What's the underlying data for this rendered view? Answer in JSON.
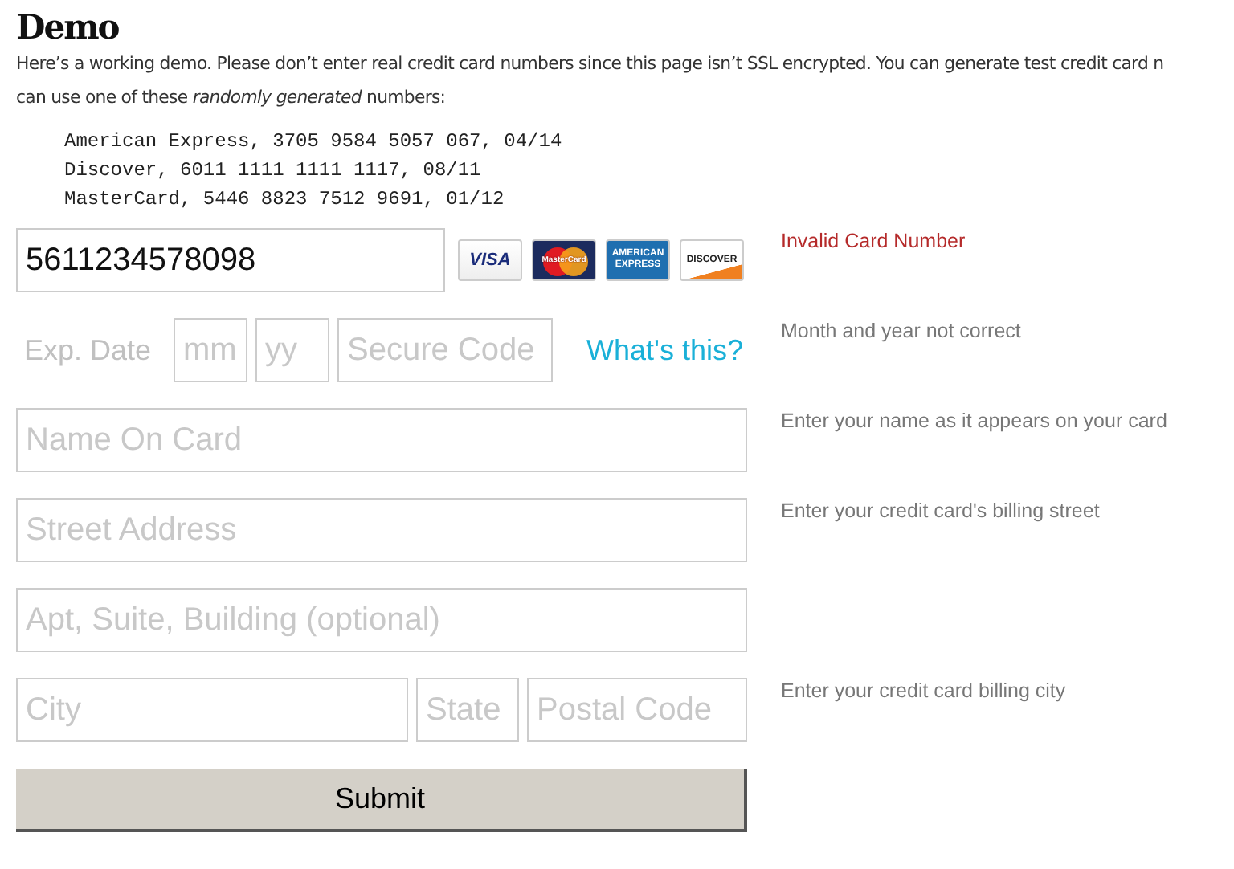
{
  "heading": "Demo",
  "intro_lines": [
    "Here’s a working demo.  Please don’t enter real credit card numbers since this page isn’t SSL encrypted.  You can generate test credit card n",
    "can use one of these *randomly generated* numbers:"
  ],
  "test_numbers": [
    "American Express, 3705 9584 5057 067, 04/14",
    "Discover, 6011 1111 1111 1117, 08/11",
    "MasterCard, 5446 8823 7512 9691, 01/12"
  ],
  "card_row": {
    "number": {
      "value": "5611234578098"
    },
    "cards": [
      {
        "kind": "visa",
        "label": "VISA"
      },
      {
        "kind": "mastercard",
        "label": "MasterCard"
      },
      {
        "kind": "amex",
        "label": "AMERICAN EXPRESS"
      },
      {
        "kind": "discover",
        "label": "DISCOVER"
      }
    ],
    "message": {
      "kind": "error",
      "text": "Invalid Card Number"
    }
  },
  "expiry_row": {
    "label": "Exp. Date",
    "month": {
      "placeholder": "mm"
    },
    "year": {
      "placeholder": "yy"
    },
    "code": {
      "placeholder": "Secure Code"
    },
    "help_link": "What's this?",
    "message": {
      "kind": "hint",
      "text": "Month and year not correct"
    }
  },
  "rows": [
    {
      "fields": [
        {
          "placeholder": "Name On Card"
        }
      ],
      "message": {
        "kind": "hint",
        "text": "Enter your name as it appears on your card"
      }
    },
    {
      "fields": [
        {
          "placeholder": "Street Address"
        }
      ],
      "message": {
        "kind": "hint",
        "text": "Enter your credit card's billing street"
      }
    },
    {
      "fields": [
        {
          "placeholder": "Apt, Suite, Building (optional)"
        }
      ]
    },
    {
      "fields": [
        {
          "placeholder": "City"
        },
        {
          "placeholder": "State"
        },
        {
          "placeholder": "Postal Code"
        }
      ],
      "message": {
        "kind": "hint",
        "text": "Enter your credit card billing city"
      }
    }
  ],
  "submit": "Submit"
}
